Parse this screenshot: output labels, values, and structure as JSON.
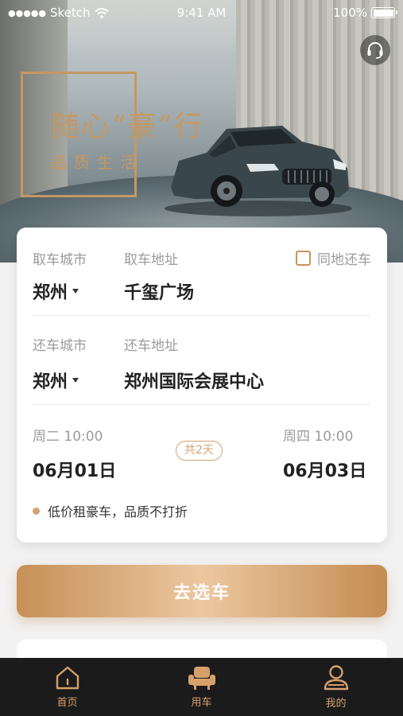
{
  "status_bar": {
    "carrier": "Sketch",
    "time": "9:41 AM",
    "battery": "100%"
  },
  "hero": {
    "slogan_title": "随心“豪”行",
    "slogan_sub": "品质生活"
  },
  "booking": {
    "pickup_city_label": "取车城市",
    "pickup_addr_label": "取车地址",
    "same_return_label": "同地还车",
    "pickup_city": "郑州",
    "pickup_addr": "千玺广场",
    "return_city_label": "还车城市",
    "return_addr_label": "还车地址",
    "return_city": "郑州",
    "return_addr": "郑州国际会展中心",
    "start_weekday_time": "周二 10:00",
    "end_weekday_time": "周四 10:00",
    "start_date": "06月01日",
    "end_date": "06月03日",
    "duration": "共2天",
    "promo": "低价租豪车，品质不打折"
  },
  "cta": {
    "label": "去选车"
  },
  "tabbar": {
    "items": [
      {
        "label": "首页",
        "icon": "home-icon"
      },
      {
        "label": "用车",
        "icon": "car-seat-icon"
      },
      {
        "label": "我的",
        "icon": "user-icon"
      }
    ]
  },
  "colors": {
    "accent": "#d4a173",
    "tabbar_bg": "#1b1b1b"
  }
}
